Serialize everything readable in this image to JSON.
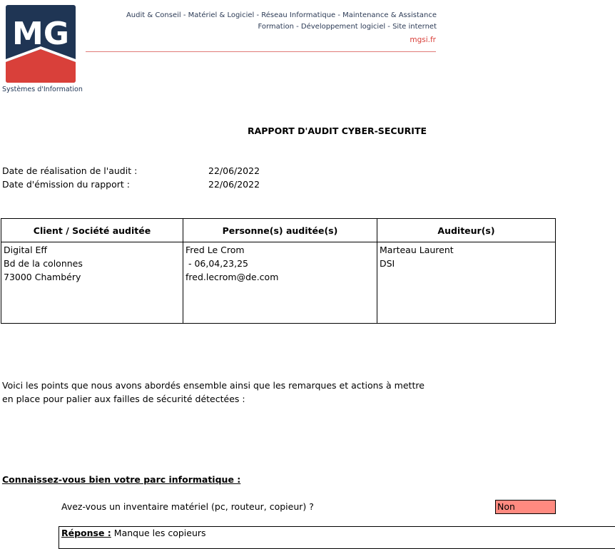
{
  "header": {
    "logo_letters": "MG",
    "logo_subtitle": "Systèmes d'Information",
    "tagline_1": "Audit & Conseil - Matériel & Logiciel - Réseau Informatique - Maintenance & Assistance",
    "tagline_2": "Formation - Développement logiciel - Site internet",
    "website": "mgsi.fr",
    "colors": {
      "navy": "#1f3554",
      "red": "#d9403a"
    }
  },
  "report": {
    "title": "RAPPORT D'AUDIT CYBER-SECURITE",
    "date_audit_label": "Date de réalisation de l'audit :",
    "date_audit_value": "22/06/2022",
    "date_report_label": "Date d'émission du rapport :",
    "date_report_value": "22/06/2022"
  },
  "info_table": {
    "headers": [
      "Client / Société auditée",
      "Personne(s) auditée(s)",
      "Auditeur(s)"
    ],
    "client": [
      "Digital Eff",
      "Bd de la colonnes",
      "73000 Chambéry"
    ],
    "person": [
      "Fred Le Crom",
      " - 06,04,23,25",
      "fred.lecrom@de.com"
    ],
    "auditor": [
      "Marteau Laurent",
      "DSI"
    ]
  },
  "intro": {
    "line_1": "Voici les points que nous avons abordés ensemble ainsi que les remarques et actions à mettre",
    "line_2": "en place pour palier aux failles de sécurité détectées :"
  },
  "section_1": {
    "title": "Connaissez-vous bien votre parc informatique :",
    "question": "Avez-vous un inventaire matériel (pc, routeur, copieur) ?",
    "answer": "Non",
    "answer_color": "#ff8a80",
    "reponse_label": "Réponse :",
    "reponse_text": " Manque les copieurs"
  }
}
